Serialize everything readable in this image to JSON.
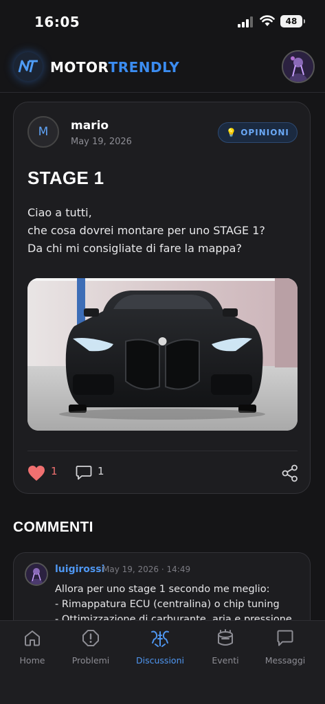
{
  "status_bar": {
    "time": "16:05",
    "battery": "48"
  },
  "header": {
    "brand_part1": "MOTOR",
    "brand_part2": "TRENDLY",
    "logo_text": "NT"
  },
  "post": {
    "author_initial": "M",
    "author": "mario",
    "date": "May 19, 2026",
    "category": "OPINIONI",
    "title": "STAGE 1",
    "body_lines": [
      "Ciao a tutti,",
      "che cosa dovrei montare per uno STAGE 1?",
      "Da chi mi consigliate di fare la mappa?"
    ],
    "likes": "1",
    "comments": "1"
  },
  "comments_section": {
    "title": "COMMENTI",
    "items": [
      {
        "user": "luigirossi",
        "date": "May 19, 2026 · 14:49",
        "lines": [
          "Allora per uno stage 1 secondo me meglio:",
          "- Rimappatura ECU (centralina) o chip tuning",
          "- Ottimizzazione di carburante, aria e pressione"
        ]
      }
    ]
  },
  "tabs": [
    {
      "label": "Home",
      "icon": "home-icon"
    },
    {
      "label": "Problemi",
      "icon": "alert-icon"
    },
    {
      "label": "Discussioni",
      "icon": "discussions-icon",
      "active": true
    },
    {
      "label": "Eventi",
      "icon": "event-icon"
    },
    {
      "label": "Messaggi",
      "icon": "message-icon"
    }
  ],
  "colors": {
    "accent": "#4f97f2",
    "like": "#f07070",
    "background": "#151517",
    "card": "#1d1d20"
  }
}
